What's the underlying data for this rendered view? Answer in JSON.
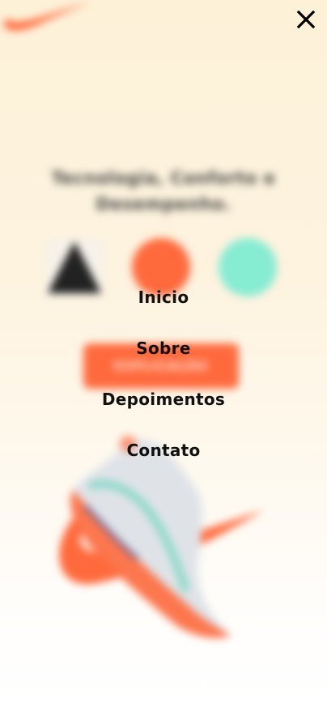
{
  "page": {
    "headline": "Tecnologia, Conforto e Desempenho.",
    "cta_label": "EXPLICAÇÃO",
    "colors": {
      "accent": "#ff6a3d",
      "mint": "#86ecd2",
      "dark": "#222222",
      "text": "#111111"
    }
  },
  "menu": {
    "close_icon": "close-icon",
    "items": [
      {
        "label": "Inicio"
      },
      {
        "label": "Sobre"
      },
      {
        "label": "Depoimentos"
      },
      {
        "label": "Contato"
      }
    ]
  }
}
